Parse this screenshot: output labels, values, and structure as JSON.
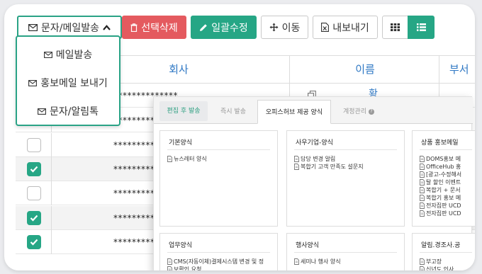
{
  "toolbar": {
    "sms_mail_label": "문자/메일발송",
    "delete_label": "선택삭제",
    "bulk_edit_label": "일괄수정",
    "move_label": "이동",
    "export_label": "내보내기"
  },
  "dropdown": {
    "items": [
      {
        "label": "메일발송"
      },
      {
        "label": "홍보메일 보내기"
      },
      {
        "label": "문자/알림톡"
      }
    ]
  },
  "table": {
    "columns": [
      "회사",
      "이름",
      "부서"
    ],
    "rows": [
      {
        "checked": false,
        "masked": "**************",
        "name": "황"
      },
      {
        "checked": false,
        "masked": "**************",
        "name": ""
      },
      {
        "checked": false,
        "masked": "**************",
        "name": ""
      },
      {
        "checked": true,
        "masked": "**************",
        "name": ""
      },
      {
        "checked": false,
        "masked": "**************",
        "name": ""
      },
      {
        "checked": true,
        "masked": "**************",
        "name": ""
      },
      {
        "checked": true,
        "masked": "**************",
        "name": ""
      }
    ]
  },
  "template_panel": {
    "tabs": [
      {
        "label": "편집 후 발송"
      },
      {
        "label": "즉시 발송"
      },
      {
        "label": "오피스허브 제공 양식"
      },
      {
        "label": "계정관리"
      }
    ],
    "sections": [
      {
        "title": "기본양식",
        "items": [
          "뉴스레터 양식"
        ]
      },
      {
        "title": "사우기업-양식",
        "items": [
          "담당 변경 알림",
          "복합기 고객 만족도 설문지"
        ]
      },
      {
        "title": "상품 홍보메일",
        "items": [
          "DOMS홍보 메",
          "OfficeHub 홍",
          "[광고-수정해서",
          "탈 할인 이벤트",
          "복합기 + 문서",
          "복합기 홍보 메",
          "전자집판 UCD",
          "전자집판 UCD"
        ]
      },
      {
        "title": "업무양식",
        "items": [
          "CMS(자동이체)결제시스템 변경 및 정",
          "보확인 요청"
        ]
      },
      {
        "title": "행사양식",
        "items": [
          "세미나 행사 양식"
        ]
      },
      {
        "title": "알림.경조사.공",
        "items": [
          "부고장",
          "신년도 인사"
        ]
      }
    ]
  },
  "colors": {
    "brand_teal": "#26a685",
    "delete_red": "#e45a5f",
    "header_blue": "#2f78c4"
  }
}
